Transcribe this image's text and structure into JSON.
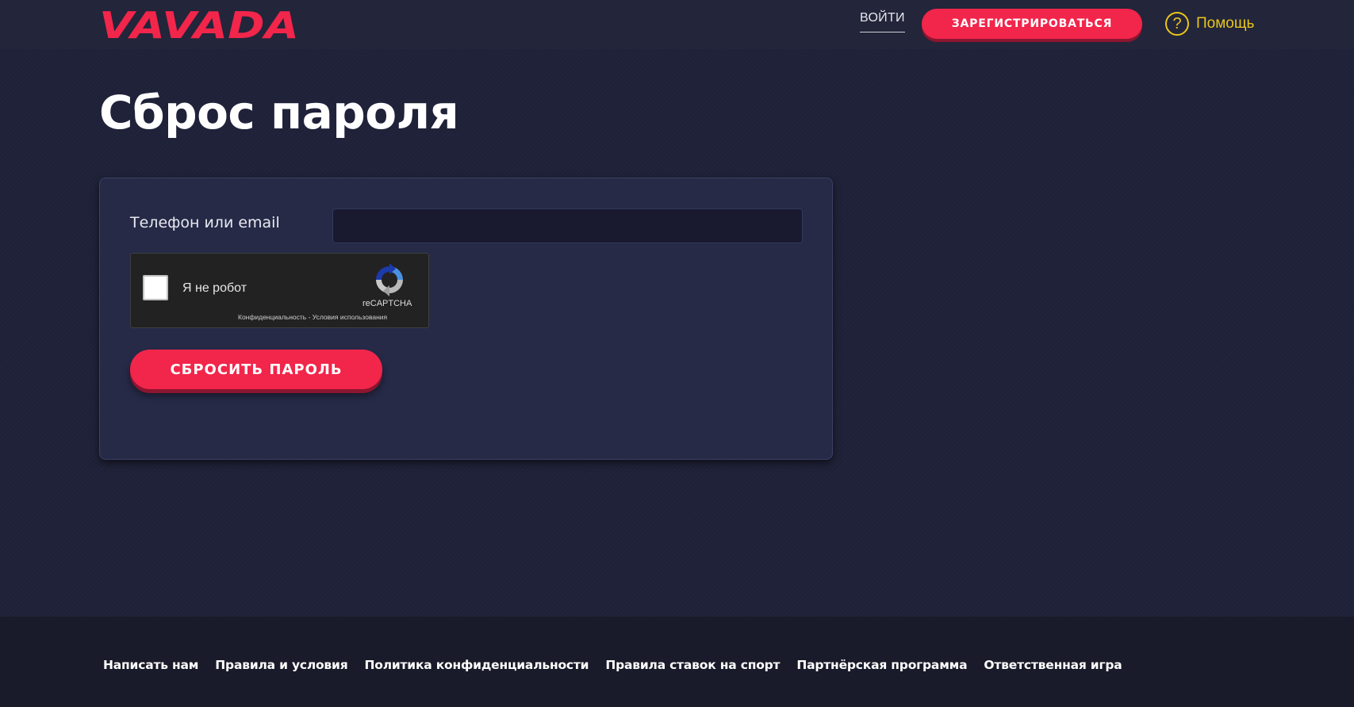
{
  "brand": {
    "logo_text": "VAVADA",
    "accent_color": "#f2254b",
    "help_color": "#e8c61c"
  },
  "header": {
    "login_label": "ВОЙТИ",
    "register_label": "ЗАРЕГИСТРИРОВАТЬСЯ",
    "help_icon": "question-circle-icon",
    "help_label": "Помощь"
  },
  "main": {
    "title": "Сброс пароля",
    "form": {
      "field_label": "Телефон или email",
      "field_value": "",
      "recaptcha": {
        "checkbox_label": "Я не робот",
        "brand": "reCAPTCHA",
        "privacy_link": "Конфиденциальность",
        "separator": " - ",
        "terms_link": "Условия использования",
        "logo_icon": "recaptcha-logo-icon"
      },
      "submit_label": "СБРОСИТЬ ПАРОЛЬ"
    }
  },
  "footer": {
    "links": [
      "Написать нам",
      "Правила и условия",
      "Политика конфиденциальности",
      "Правила ставок на спорт",
      "Партнёрская программа",
      "Ответственная игра"
    ]
  }
}
